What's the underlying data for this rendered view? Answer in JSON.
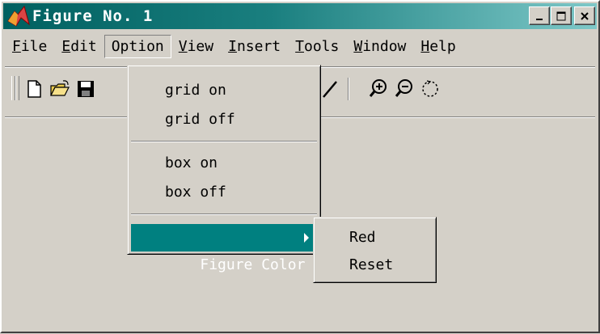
{
  "window": {
    "title": "Figure No. 1",
    "title_gradient": [
      "#006060",
      "#7ec8c8"
    ],
    "controls": [
      "minimize-icon",
      "maximize-icon",
      "close-icon"
    ]
  },
  "menubar": {
    "items": [
      {
        "accel": "F",
        "rest": "ile"
      },
      {
        "accel": "E",
        "rest": "dit"
      },
      {
        "accel": "",
        "rest": "Option"
      },
      {
        "accel": "V",
        "rest": "iew"
      },
      {
        "accel": "I",
        "rest": "nsert"
      },
      {
        "accel": "T",
        "rest": "ools"
      },
      {
        "accel": "W",
        "rest": "indow"
      },
      {
        "accel": "H",
        "rest": "elp"
      }
    ]
  },
  "toolbar": {
    "icons": [
      "new-file-icon",
      "open-folder-icon",
      "save-icon",
      "line-tool-icon",
      "zoom-in-icon",
      "zoom-out-icon",
      "rotate-icon"
    ]
  },
  "option_menu": {
    "items": [
      {
        "label": "grid on"
      },
      {
        "label": "grid off"
      },
      {
        "label": "box on"
      },
      {
        "label": "box off"
      },
      {
        "label": "Figure Color"
      }
    ],
    "highlight_color": "#008080"
  },
  "figure_color_submenu": {
    "items": [
      {
        "label": "Red"
      },
      {
        "label": "Reset"
      }
    ]
  }
}
